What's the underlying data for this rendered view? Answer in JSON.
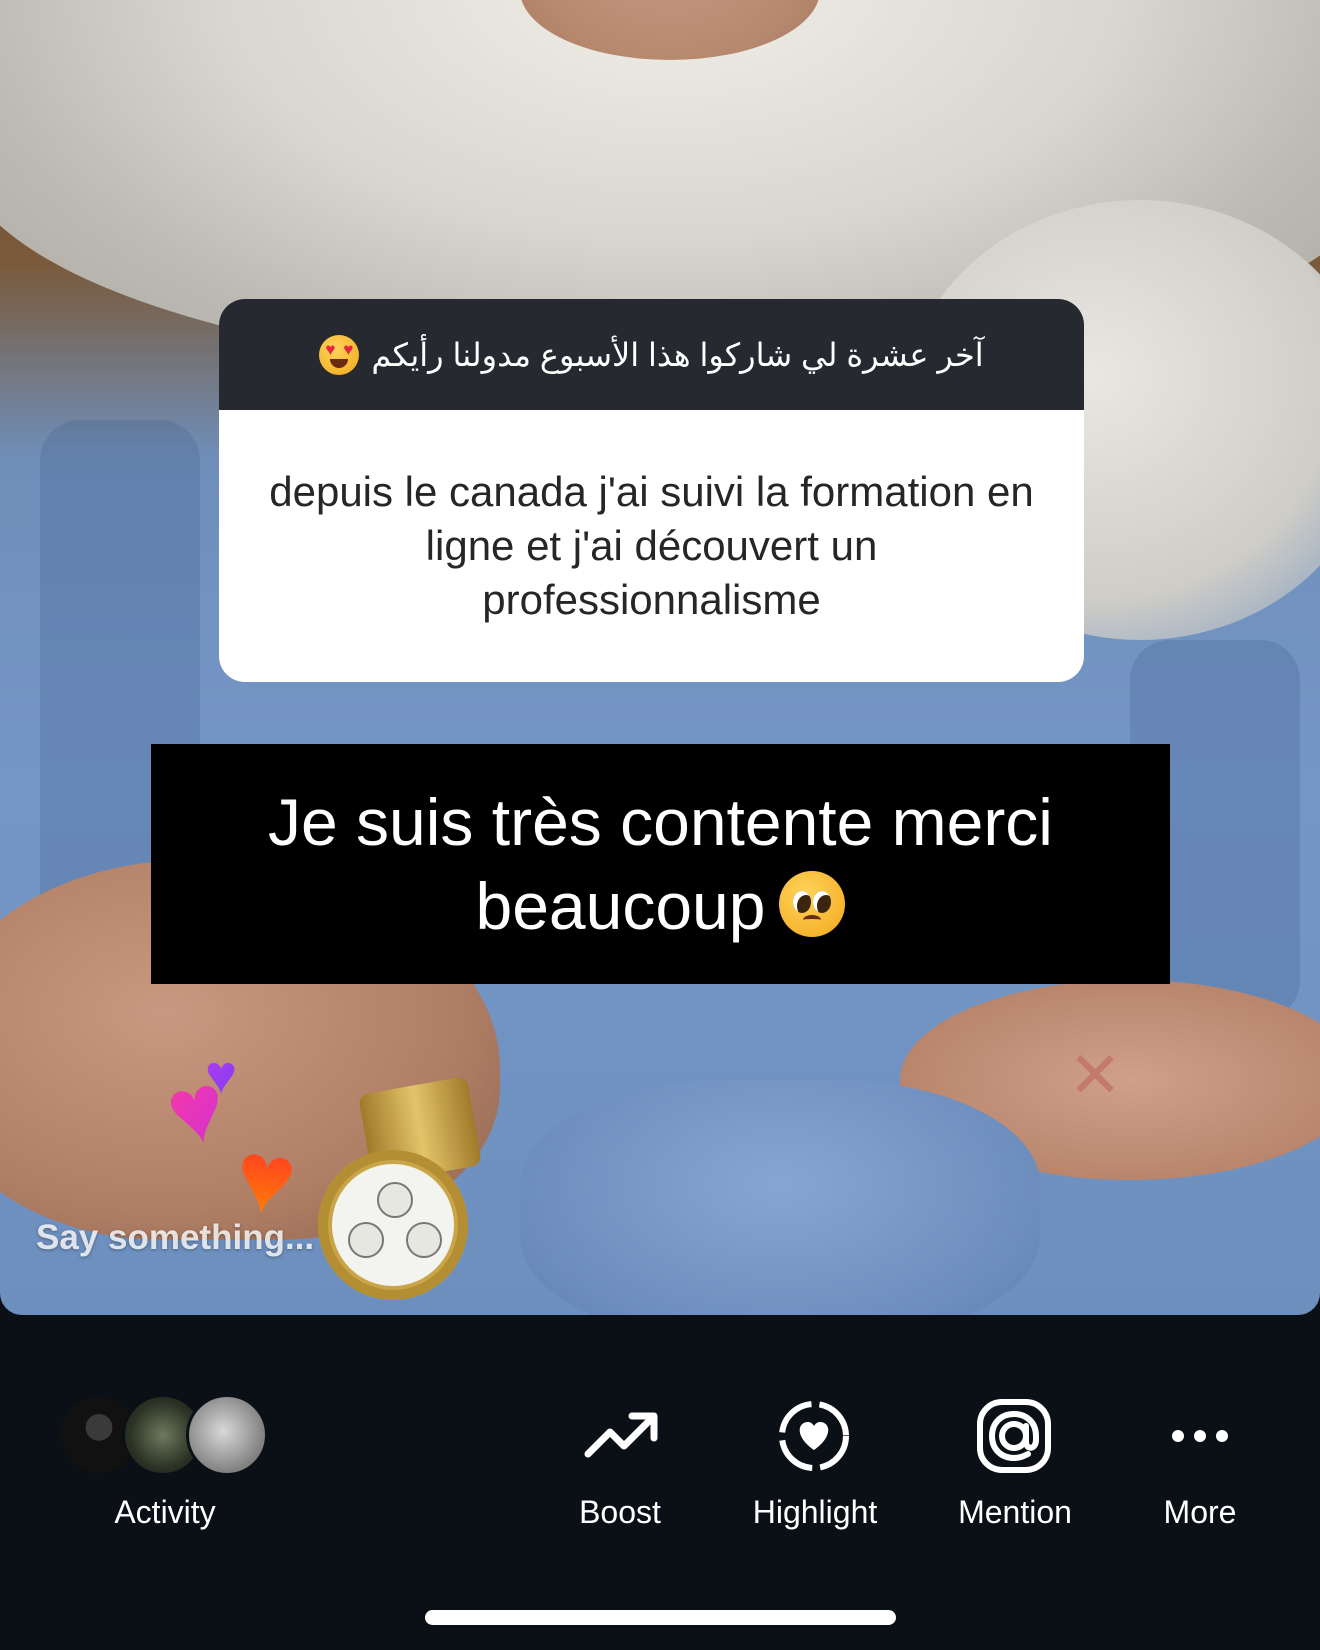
{
  "story": {
    "question_prompt": "آخر عشرة لي شاركوا هذا الأسبوع مدولنا رأيكم",
    "question_emoji": "heart-eyes-emoji",
    "question_response": "depuis le canada j'ai suivi la formation en ligne et j'ai découvert un professionnalisme",
    "answer_text": "Je suis très contente merci beaucoup",
    "answer_emoji": "pleading-face-emoji",
    "reply_placeholder": "Say something..."
  },
  "bottom_bar": {
    "activity_label": "Activity",
    "actions": [
      {
        "label": "Boost",
        "icon": "trending-up-icon"
      },
      {
        "label": "Highlight",
        "icon": "highlight-heart-icon"
      },
      {
        "label": "Mention",
        "icon": "at-sign-icon"
      },
      {
        "label": "More",
        "icon": "more-horizontal-icon"
      }
    ]
  },
  "colors": {
    "background": "#0b1016",
    "question_header": "#262a30",
    "answer_background": "#000000"
  }
}
